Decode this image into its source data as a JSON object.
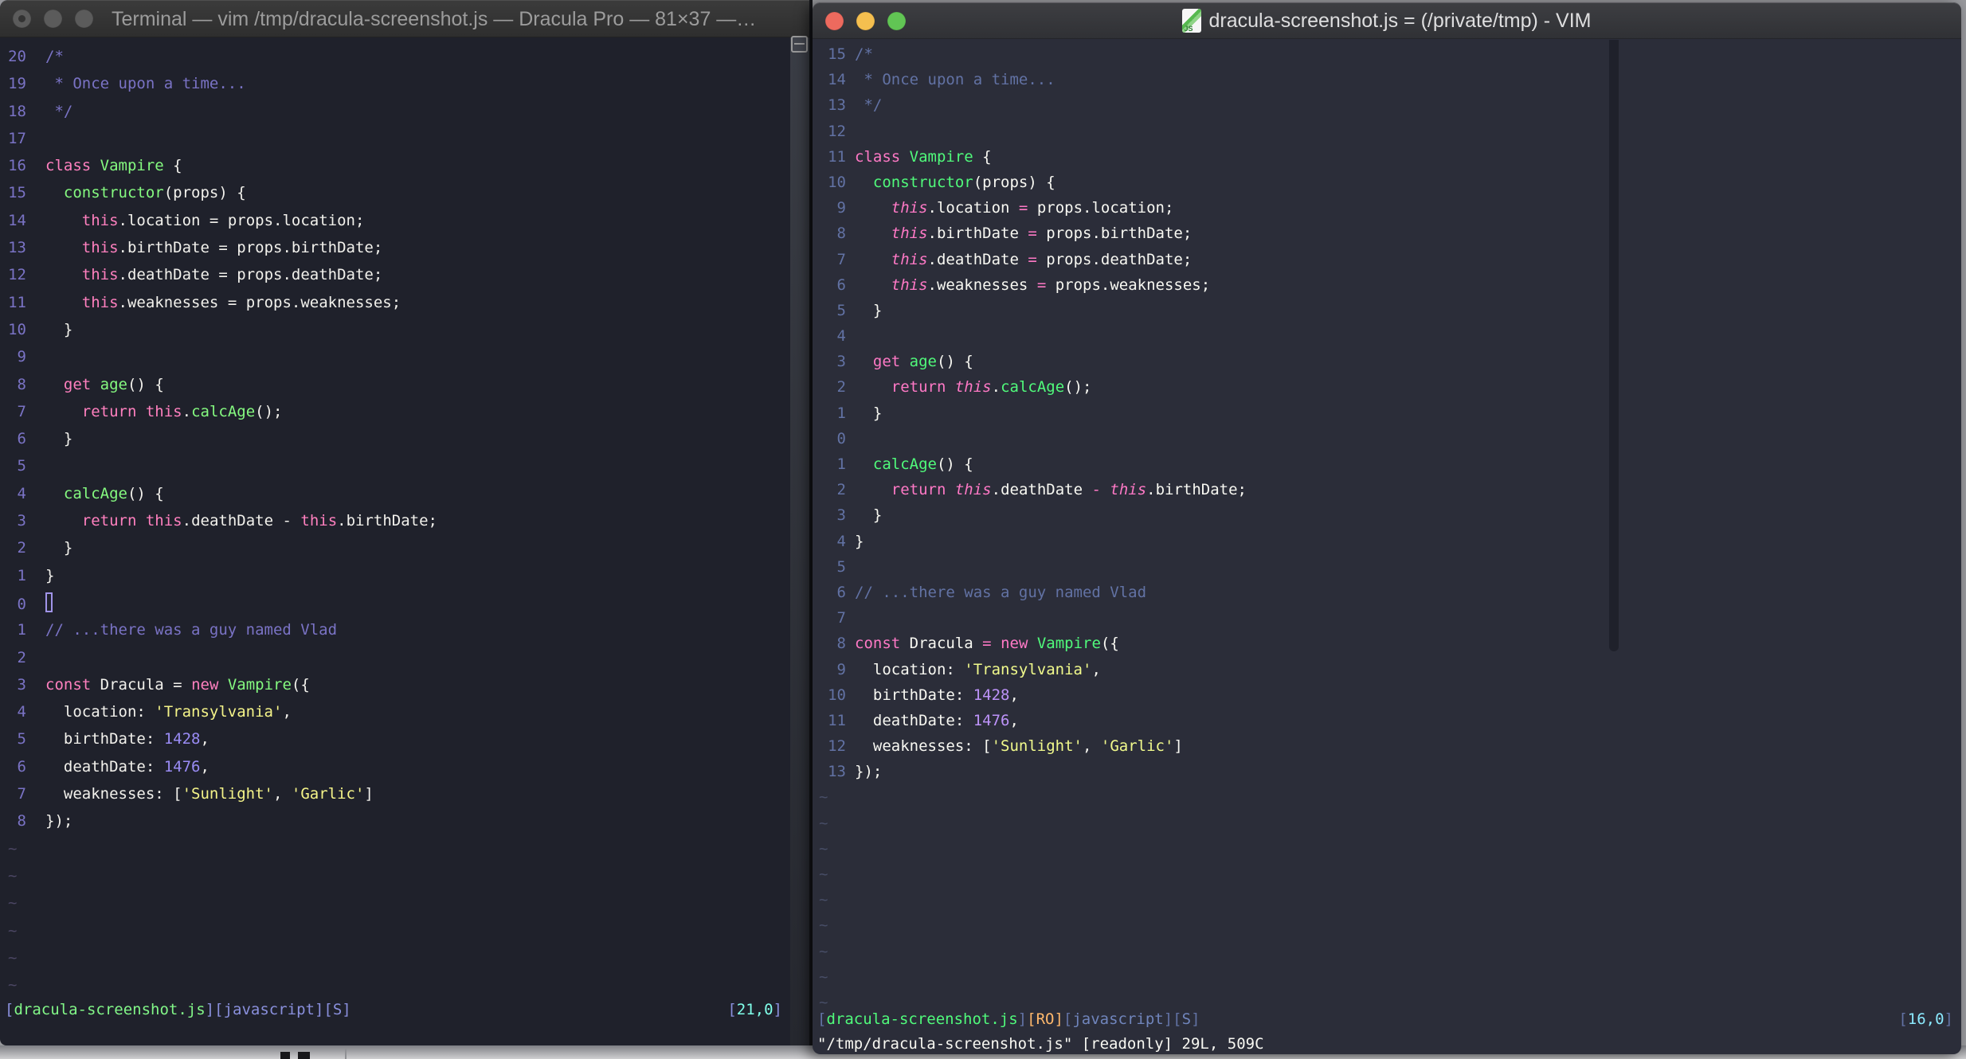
{
  "code_lines": [
    [
      [
        "c",
        "/*"
      ]
    ],
    [
      [
        "c",
        " * Once upon a time..."
      ]
    ],
    [
      [
        "c",
        " */"
      ]
    ],
    [],
    [
      [
        "p",
        "class"
      ],
      [
        "w",
        " "
      ],
      [
        "g",
        "Vampire"
      ],
      [
        "w",
        " {"
      ]
    ],
    [
      [
        "w",
        "  "
      ],
      [
        "g",
        "constructor"
      ],
      [
        "w",
        "(props) {"
      ]
    ],
    [
      [
        "w",
        "    "
      ],
      [
        "t",
        "this"
      ],
      [
        "w",
        ".location "
      ],
      [
        "o",
        "="
      ],
      [
        "w",
        " props.location;"
      ]
    ],
    [
      [
        "w",
        "    "
      ],
      [
        "t",
        "this"
      ],
      [
        "w",
        ".birthDate "
      ],
      [
        "o",
        "="
      ],
      [
        "w",
        " props.birthDate;"
      ]
    ],
    [
      [
        "w",
        "    "
      ],
      [
        "t",
        "this"
      ],
      [
        "w",
        ".deathDate "
      ],
      [
        "o",
        "="
      ],
      [
        "w",
        " props.deathDate;"
      ]
    ],
    [
      [
        "w",
        "    "
      ],
      [
        "t",
        "this"
      ],
      [
        "w",
        ".weaknesses "
      ],
      [
        "o",
        "="
      ],
      [
        "w",
        " props.weaknesses;"
      ]
    ],
    [
      [
        "w",
        "  }"
      ]
    ],
    [],
    [
      [
        "w",
        "  "
      ],
      [
        "p",
        "get"
      ],
      [
        "w",
        " "
      ],
      [
        "g",
        "age"
      ],
      [
        "w",
        "() {"
      ]
    ],
    [
      [
        "w",
        "    "
      ],
      [
        "p",
        "return"
      ],
      [
        "w",
        " "
      ],
      [
        "t",
        "this"
      ],
      [
        "w",
        "."
      ],
      [
        "g",
        "calcAge"
      ],
      [
        "w",
        "();"
      ]
    ],
    [
      [
        "w",
        "  }"
      ]
    ],
    [],
    [
      [
        "w",
        "  "
      ],
      [
        "g",
        "calcAge"
      ],
      [
        "w",
        "() {"
      ]
    ],
    [
      [
        "w",
        "    "
      ],
      [
        "p",
        "return"
      ],
      [
        "w",
        " "
      ],
      [
        "t",
        "this"
      ],
      [
        "w",
        ".deathDate "
      ],
      [
        "o",
        "-"
      ],
      [
        "w",
        " "
      ],
      [
        "t",
        "this"
      ],
      [
        "w",
        ".birthDate;"
      ]
    ],
    [
      [
        "w",
        "  }"
      ]
    ],
    [
      [
        "w",
        "}"
      ]
    ],
    [],
    [
      [
        "c",
        "// ...there was a guy named Vlad"
      ]
    ],
    [],
    [
      [
        "p",
        "const"
      ],
      [
        "w",
        " Dracula "
      ],
      [
        "o",
        "="
      ],
      [
        "w",
        " "
      ],
      [
        "p",
        "new"
      ],
      [
        "w",
        " "
      ],
      [
        "g",
        "Vampire"
      ],
      [
        "w",
        "({"
      ]
    ],
    [
      [
        "w",
        "  location: "
      ],
      [
        "y",
        "'Transylvania'"
      ],
      [
        "w",
        ","
      ]
    ],
    [
      [
        "w",
        "  birthDate: "
      ],
      [
        "n",
        "1428"
      ],
      [
        "w",
        ","
      ]
    ],
    [
      [
        "w",
        "  deathDate: "
      ],
      [
        "n",
        "1476"
      ],
      [
        "w",
        ","
      ]
    ],
    [
      [
        "w",
        "  weaknesses: ["
      ],
      [
        "y",
        "'Sunlight'"
      ],
      [
        "w",
        ", "
      ],
      [
        "y",
        "'Garlic'"
      ],
      [
        "w",
        "]"
      ]
    ],
    [
      [
        "w",
        "});"
      ]
    ]
  ],
  "left_window": {
    "app": "Terminal",
    "title": "Terminal — vim /tmp/dracula-screenshot.js — Dracula Pro — 81×37 —…",
    "rel_numbers": [
      "20",
      "19",
      "18",
      "17",
      "16",
      "15",
      "14",
      "13",
      "12",
      "11",
      "10",
      "9",
      "8",
      "7",
      "6",
      "5",
      "4",
      "3",
      "2",
      "1",
      "0",
      "1",
      "2",
      "3",
      "4",
      "5",
      "6",
      "7",
      "8"
    ],
    "tilde_rows": 6,
    "cursor_row": 20,
    "status_left": [
      [
        "br",
        "["
      ],
      [
        "fn",
        "dracula-screenshot.js"
      ],
      [
        "br",
        "]["
      ],
      [
        "ft",
        "javascript"
      ],
      [
        "br",
        "]["
      ],
      [
        "ft",
        "S"
      ],
      [
        "br",
        "]"
      ]
    ],
    "status_right": [
      [
        "br",
        "["
      ],
      [
        "pos",
        "21,0"
      ],
      [
        "br",
        "]"
      ]
    ],
    "lights": [
      "#5b5b5b",
      "#5b5b5b",
      "#5b5b5b"
    ],
    "palette": {
      "bg": "#1f212b",
      "fg": "#f2f1ec",
      "ln": "#7a73c5",
      "cm": "#7a73c5",
      "pink": "#ff80bf",
      "green": "#85fa80",
      "yellow": "#f5f489",
      "num": "#9a8cf5",
      "op": "#f2f1ec",
      "this": "#ff80bf",
      "tilde": "#4b4663",
      "sbr": "#8a90dd",
      "sfn": "#82f788",
      "sft": "#8a90dd",
      "sro": "#ffca80",
      "spos": "#80ffea",
      "cursor": "#a094e8",
      "cmd": "#f2f1ec"
    }
  },
  "right_window": {
    "app": "MacVim",
    "title": "dracula-screenshot.js = (/private/tmp) - VIM",
    "icon": "js-document-icon",
    "icon_js_label": "JS",
    "rel_numbers": [
      "15",
      "14",
      "13",
      "12",
      "11",
      "10",
      "9",
      "8",
      "7",
      "6",
      "5",
      "4",
      "3",
      "2",
      "1",
      "0",
      "1",
      "2",
      "3",
      "4",
      "5",
      "6",
      "7",
      "8",
      "9",
      "10",
      "11",
      "12",
      "13"
    ],
    "tilde_rows": 9,
    "cursor_row": -1,
    "status_left": [
      [
        "br",
        "["
      ],
      [
        "fn",
        "dracula-screenshot.js"
      ],
      [
        "br",
        "]"
      ],
      [
        "ro",
        "[RO]"
      ],
      [
        "br",
        "["
      ],
      [
        "ft",
        "javascript"
      ],
      [
        "br",
        "]["
      ],
      [
        "ft",
        "S"
      ],
      [
        "br",
        "]"
      ]
    ],
    "status_right": [
      [
        "br",
        "["
      ],
      [
        "pos",
        "16,0"
      ],
      [
        "br",
        "]"
      ]
    ],
    "cmdline": "\"/tmp/dracula-screenshot.js\" [readonly] 29L, 509C",
    "lights": [
      "#ed6a5e",
      "#f5bf4f",
      "#61c554"
    ],
    "palette": {
      "bg": "#2b2d39",
      "fg": "#f8f8f2",
      "ln": "#6272a4",
      "cm": "#6272a4",
      "pink": "#ff79c6",
      "green": "#50fa7b",
      "yellow": "#f1fa8c",
      "num": "#bd93f9",
      "op": "#ff79c6",
      "this": "#ff79c6",
      "tilde": "#474d66",
      "sbr": "#6272a4",
      "sfn": "#50fa7b",
      "sft": "#7085bc",
      "sro": "#ffb86c",
      "spos": "#8be9fd",
      "cursor": "#f8f8f2",
      "cmd": "#f8f8f2"
    }
  }
}
